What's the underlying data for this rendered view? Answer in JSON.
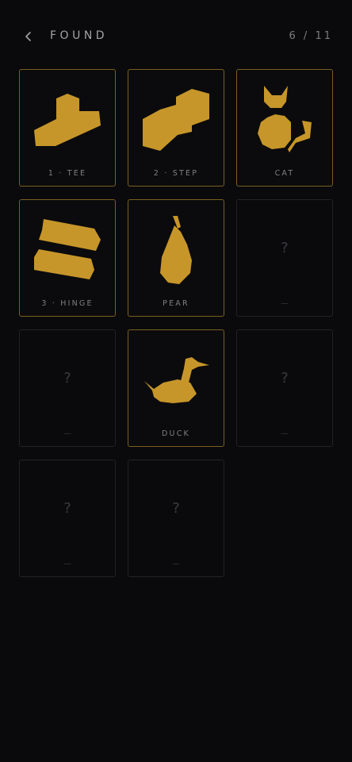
{
  "header": {
    "title": "FOUND",
    "counter": "6 / 11"
  },
  "theme": {
    "accent": "#c7962a",
    "border_found": "#7a5e20",
    "border_locked": "#232326",
    "background": "#0a0a0c"
  },
  "cards": [
    {
      "label": "1 · TEE",
      "found": true,
      "icon": "tee-shape-icon"
    },
    {
      "label": "2 · STEP",
      "found": true,
      "icon": "step-shape-icon"
    },
    {
      "label": "CAT",
      "found": true,
      "icon": "cat-shape-icon"
    },
    {
      "label": "3 · HINGE",
      "found": true,
      "icon": "hinge-shape-icon"
    },
    {
      "label": "PEAR",
      "found": true,
      "icon": "pear-shape-icon"
    },
    {
      "label": "—",
      "found": false,
      "placeholder": "?"
    },
    {
      "label": "—",
      "found": false,
      "placeholder": "?"
    },
    {
      "label": "DUCK",
      "found": true,
      "icon": "duck-shape-icon"
    },
    {
      "label": "—",
      "found": false,
      "placeholder": "?"
    },
    {
      "label": "—",
      "found": false,
      "placeholder": "?"
    },
    {
      "label": "—",
      "found": false,
      "placeholder": "?"
    }
  ]
}
